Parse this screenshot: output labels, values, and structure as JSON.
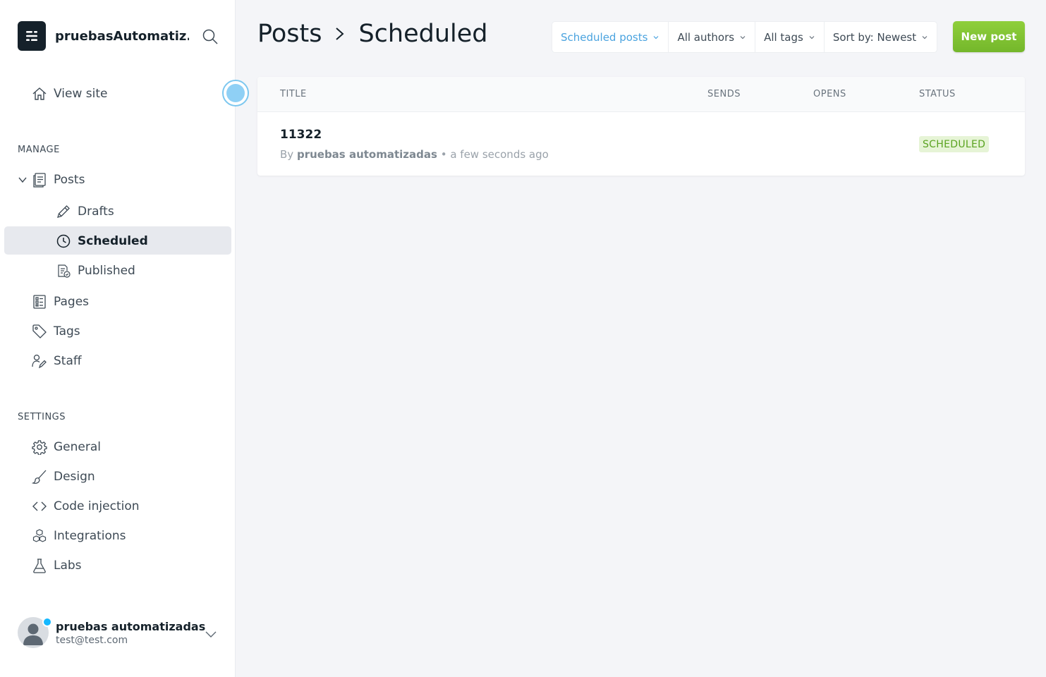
{
  "sidebar": {
    "site_name": "pruebasAutomatiz...",
    "view_site": "View site",
    "manage_label": "MANAGE",
    "posts": "Posts",
    "drafts": "Drafts",
    "scheduled": "Scheduled",
    "published": "Published",
    "pages": "Pages",
    "tags": "Tags",
    "staff": "Staff",
    "settings_label": "SETTINGS",
    "general": "General",
    "design": "Design",
    "code_injection": "Code injection",
    "integrations": "Integrations",
    "labs": "Labs"
  },
  "user": {
    "name": "pruebas automatizadas",
    "email": "test@test.com"
  },
  "header": {
    "crumb_parent": "Posts",
    "crumb_current": "Scheduled"
  },
  "filters": {
    "type": "Scheduled posts",
    "author": "All authors",
    "tag": "All tags",
    "sort": "Sort by: Newest"
  },
  "new_post_label": "New post",
  "table": {
    "columns": {
      "title": "TITLE",
      "sends": "SENDS",
      "opens": "OPENS",
      "status": "STATUS"
    },
    "rows": [
      {
        "title": "11322",
        "by": "By",
        "author": "pruebas automatizadas",
        "time": "• a few seconds ago",
        "status": "SCHEDULED"
      }
    ]
  },
  "colors": {
    "accent_blue": "#4aa3df",
    "primary_green": "#7fc233",
    "status_green": "#5aa320",
    "active_nav_bg": "#e7e9ee"
  },
  "icons": {
    "brand": "ghost-logo-icon",
    "search": "search-icon",
    "view_site": "home-icon",
    "posts": "document-icon",
    "drafts": "pencil-icon",
    "scheduled": "clock-icon",
    "published": "published-document-icon",
    "pages": "pages-icon",
    "tags": "tag-icon",
    "staff": "staff-icon",
    "general": "gear-icon",
    "design": "brush-icon",
    "code_injection": "code-icon",
    "integrations": "cubes-icon",
    "labs": "flask-icon"
  }
}
